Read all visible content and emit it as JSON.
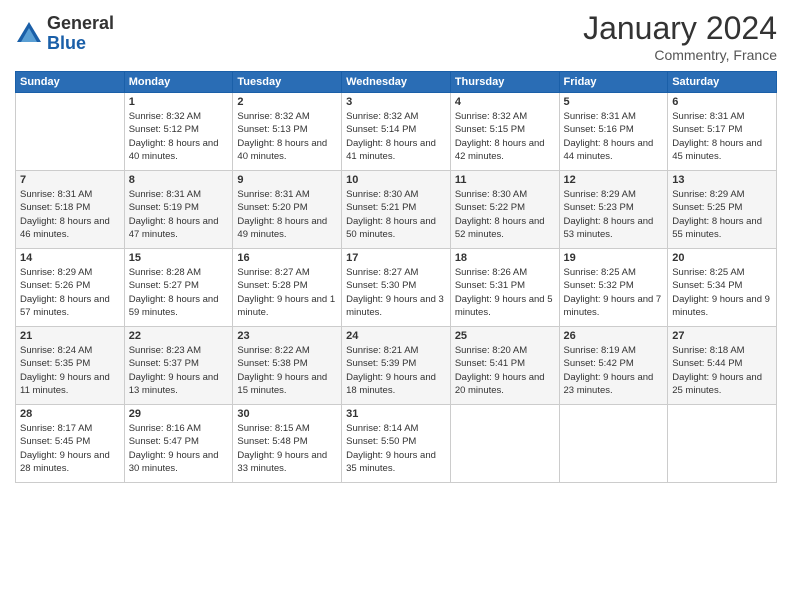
{
  "logo": {
    "general": "General",
    "blue": "Blue"
  },
  "title": "January 2024",
  "location": "Commentry, France",
  "days_header": [
    "Sunday",
    "Monday",
    "Tuesday",
    "Wednesday",
    "Thursday",
    "Friday",
    "Saturday"
  ],
  "weeks": [
    [
      {
        "day": "",
        "sunrise": "",
        "sunset": "",
        "daylight": ""
      },
      {
        "day": "1",
        "sunrise": "Sunrise: 8:32 AM",
        "sunset": "Sunset: 5:12 PM",
        "daylight": "Daylight: 8 hours and 40 minutes."
      },
      {
        "day": "2",
        "sunrise": "Sunrise: 8:32 AM",
        "sunset": "Sunset: 5:13 PM",
        "daylight": "Daylight: 8 hours and 40 minutes."
      },
      {
        "day": "3",
        "sunrise": "Sunrise: 8:32 AM",
        "sunset": "Sunset: 5:14 PM",
        "daylight": "Daylight: 8 hours and 41 minutes."
      },
      {
        "day": "4",
        "sunrise": "Sunrise: 8:32 AM",
        "sunset": "Sunset: 5:15 PM",
        "daylight": "Daylight: 8 hours and 42 minutes."
      },
      {
        "day": "5",
        "sunrise": "Sunrise: 8:31 AM",
        "sunset": "Sunset: 5:16 PM",
        "daylight": "Daylight: 8 hours and 44 minutes."
      },
      {
        "day": "6",
        "sunrise": "Sunrise: 8:31 AM",
        "sunset": "Sunset: 5:17 PM",
        "daylight": "Daylight: 8 hours and 45 minutes."
      }
    ],
    [
      {
        "day": "7",
        "sunrise": "Sunrise: 8:31 AM",
        "sunset": "Sunset: 5:18 PM",
        "daylight": "Daylight: 8 hours and 46 minutes."
      },
      {
        "day": "8",
        "sunrise": "Sunrise: 8:31 AM",
        "sunset": "Sunset: 5:19 PM",
        "daylight": "Daylight: 8 hours and 47 minutes."
      },
      {
        "day": "9",
        "sunrise": "Sunrise: 8:31 AM",
        "sunset": "Sunset: 5:20 PM",
        "daylight": "Daylight: 8 hours and 49 minutes."
      },
      {
        "day": "10",
        "sunrise": "Sunrise: 8:30 AM",
        "sunset": "Sunset: 5:21 PM",
        "daylight": "Daylight: 8 hours and 50 minutes."
      },
      {
        "day": "11",
        "sunrise": "Sunrise: 8:30 AM",
        "sunset": "Sunset: 5:22 PM",
        "daylight": "Daylight: 8 hours and 52 minutes."
      },
      {
        "day": "12",
        "sunrise": "Sunrise: 8:29 AM",
        "sunset": "Sunset: 5:23 PM",
        "daylight": "Daylight: 8 hours and 53 minutes."
      },
      {
        "day": "13",
        "sunrise": "Sunrise: 8:29 AM",
        "sunset": "Sunset: 5:25 PM",
        "daylight": "Daylight: 8 hours and 55 minutes."
      }
    ],
    [
      {
        "day": "14",
        "sunrise": "Sunrise: 8:29 AM",
        "sunset": "Sunset: 5:26 PM",
        "daylight": "Daylight: 8 hours and 57 minutes."
      },
      {
        "day": "15",
        "sunrise": "Sunrise: 8:28 AM",
        "sunset": "Sunset: 5:27 PM",
        "daylight": "Daylight: 8 hours and 59 minutes."
      },
      {
        "day": "16",
        "sunrise": "Sunrise: 8:27 AM",
        "sunset": "Sunset: 5:28 PM",
        "daylight": "Daylight: 9 hours and 1 minute."
      },
      {
        "day": "17",
        "sunrise": "Sunrise: 8:27 AM",
        "sunset": "Sunset: 5:30 PM",
        "daylight": "Daylight: 9 hours and 3 minutes."
      },
      {
        "day": "18",
        "sunrise": "Sunrise: 8:26 AM",
        "sunset": "Sunset: 5:31 PM",
        "daylight": "Daylight: 9 hours and 5 minutes."
      },
      {
        "day": "19",
        "sunrise": "Sunrise: 8:25 AM",
        "sunset": "Sunset: 5:32 PM",
        "daylight": "Daylight: 9 hours and 7 minutes."
      },
      {
        "day": "20",
        "sunrise": "Sunrise: 8:25 AM",
        "sunset": "Sunset: 5:34 PM",
        "daylight": "Daylight: 9 hours and 9 minutes."
      }
    ],
    [
      {
        "day": "21",
        "sunrise": "Sunrise: 8:24 AM",
        "sunset": "Sunset: 5:35 PM",
        "daylight": "Daylight: 9 hours and 11 minutes."
      },
      {
        "day": "22",
        "sunrise": "Sunrise: 8:23 AM",
        "sunset": "Sunset: 5:37 PM",
        "daylight": "Daylight: 9 hours and 13 minutes."
      },
      {
        "day": "23",
        "sunrise": "Sunrise: 8:22 AM",
        "sunset": "Sunset: 5:38 PM",
        "daylight": "Daylight: 9 hours and 15 minutes."
      },
      {
        "day": "24",
        "sunrise": "Sunrise: 8:21 AM",
        "sunset": "Sunset: 5:39 PM",
        "daylight": "Daylight: 9 hours and 18 minutes."
      },
      {
        "day": "25",
        "sunrise": "Sunrise: 8:20 AM",
        "sunset": "Sunset: 5:41 PM",
        "daylight": "Daylight: 9 hours and 20 minutes."
      },
      {
        "day": "26",
        "sunrise": "Sunrise: 8:19 AM",
        "sunset": "Sunset: 5:42 PM",
        "daylight": "Daylight: 9 hours and 23 minutes."
      },
      {
        "day": "27",
        "sunrise": "Sunrise: 8:18 AM",
        "sunset": "Sunset: 5:44 PM",
        "daylight": "Daylight: 9 hours and 25 minutes."
      }
    ],
    [
      {
        "day": "28",
        "sunrise": "Sunrise: 8:17 AM",
        "sunset": "Sunset: 5:45 PM",
        "daylight": "Daylight: 9 hours and 28 minutes."
      },
      {
        "day": "29",
        "sunrise": "Sunrise: 8:16 AM",
        "sunset": "Sunset: 5:47 PM",
        "daylight": "Daylight: 9 hours and 30 minutes."
      },
      {
        "day": "30",
        "sunrise": "Sunrise: 8:15 AM",
        "sunset": "Sunset: 5:48 PM",
        "daylight": "Daylight: 9 hours and 33 minutes."
      },
      {
        "day": "31",
        "sunrise": "Sunrise: 8:14 AM",
        "sunset": "Sunset: 5:50 PM",
        "daylight": "Daylight: 9 hours and 35 minutes."
      },
      {
        "day": "",
        "sunrise": "",
        "sunset": "",
        "daylight": ""
      },
      {
        "day": "",
        "sunrise": "",
        "sunset": "",
        "daylight": ""
      },
      {
        "day": "",
        "sunrise": "",
        "sunset": "",
        "daylight": ""
      }
    ]
  ]
}
